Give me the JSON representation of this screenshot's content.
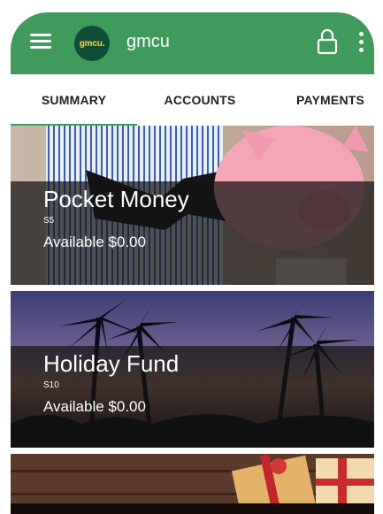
{
  "app": {
    "title": "gmcu",
    "logo_text": "gmcu."
  },
  "tabs": [
    {
      "label": "SUMMARY",
      "active": true
    },
    {
      "label": "ACCOUNTS",
      "active": false
    },
    {
      "label": "PAYMENTS",
      "active": false
    }
  ],
  "accounts": [
    {
      "name": "Pocket Money",
      "number": "S5",
      "available": "Available $0.00",
      "image": "piggy-bank-photo"
    },
    {
      "name": "Holiday Fund",
      "number": "S10",
      "available": "Available $0.00",
      "image": "palm-trees-sunset-photo"
    },
    {
      "name": "",
      "number": "",
      "available": "",
      "image": "gift-boxes-photo"
    }
  ],
  "colors": {
    "brand_green": "#3f9a5c",
    "logo_dark": "#0f4d36",
    "logo_text": "#ffd23a"
  },
  "icons": [
    "menu-icon",
    "lock-icon",
    "more-vertical-icon"
  ]
}
